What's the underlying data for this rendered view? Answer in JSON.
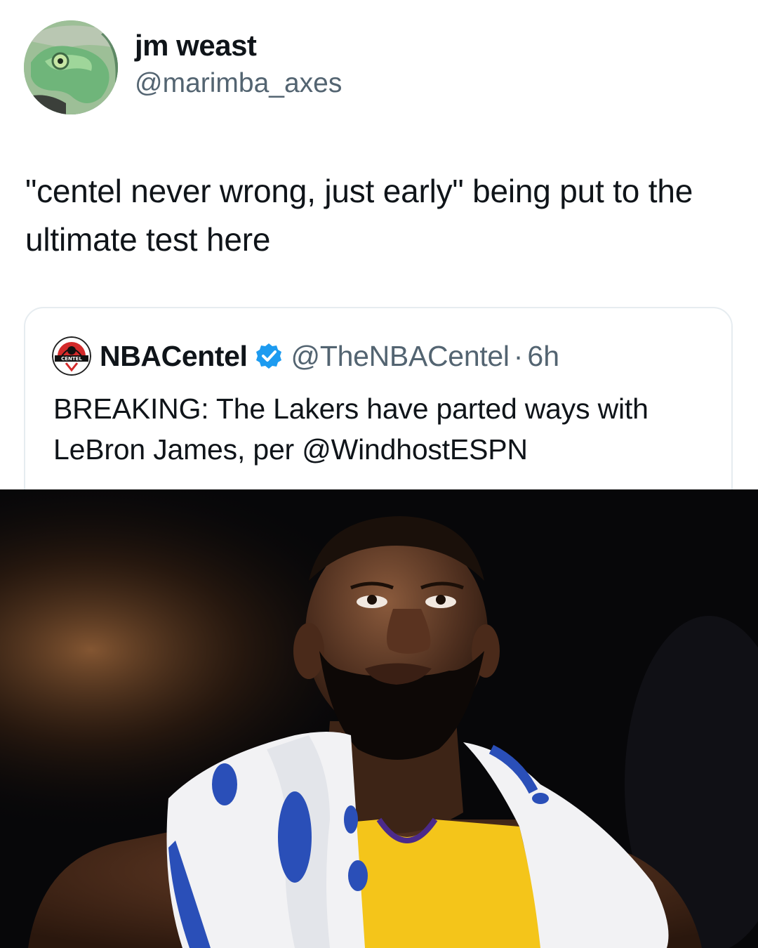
{
  "author": {
    "display_name": "jm weast",
    "handle": "@marimba_axes",
    "avatar_icon": "chameleon-avatar"
  },
  "tweet": {
    "text": "\"centel never wrong, just early\" being put to the ultimate test here"
  },
  "quoted_tweet": {
    "display_name": "NBACentel",
    "handle": "@TheNBACentel",
    "separator": "·",
    "time": "6h",
    "text": "BREAKING: The Lakers have parted ways with LeBron James, per @WindhostESPN",
    "avatar_icon": "centel-logo-icon",
    "avatar_text": "CENTEL",
    "verified_icon": "verified-badge-icon",
    "verified_color": "#1d9bf0"
  },
  "photo": {
    "description_icon": "player-photo",
    "jersey_color": "#f4c51a",
    "towel_accent_color": "#2a4fb8"
  }
}
